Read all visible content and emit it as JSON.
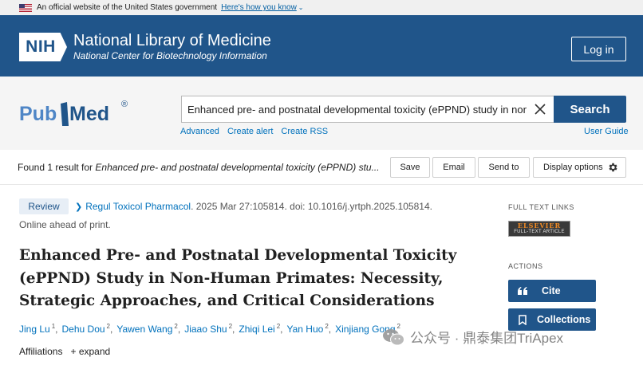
{
  "gov_banner": {
    "text": "An official website of the United States government",
    "link": "Here's how you know"
  },
  "nih": {
    "logo_text": "NIH",
    "title": "National Library of Medicine",
    "subtitle": "National Center for Biotechnology Information",
    "login": "Log in"
  },
  "search": {
    "logo_pub": "Pub",
    "logo_med": "Med",
    "logo_reg": "®",
    "query": "Enhanced pre- and postnatal developmental toxicity (ePPND) study in non-human primates",
    "button": "Search",
    "links": [
      "Advanced",
      "Create alert",
      "Create RSS"
    ],
    "user_guide": "User Guide"
  },
  "results": {
    "found_prefix": "Found 1 result for ",
    "found_query": "Enhanced pre- and postnatal developmental toxicity (ePPND) stu...",
    "save": "Save",
    "email": "Email",
    "send_to": "Send to",
    "display_options": "Display options"
  },
  "article": {
    "badge": "Review",
    "journal": "Regul Toxicol Pharmacol",
    "citation_rest": ". 2025 Mar 27:105814. doi: 10.1016/j.yrtph.2025.105814.",
    "status": "Online ahead of print.",
    "title": "Enhanced Pre- and Postnatal Developmental Toxicity (ePPND) Study in Non-Human Primates: Necessity, Strategic Approaches, and Critical Considerations",
    "authors": [
      {
        "name": "Jing Lu",
        "sup": "1"
      },
      {
        "name": "Dehu Dou",
        "sup": "2"
      },
      {
        "name": "Yawen Wang",
        "sup": "2"
      },
      {
        "name": "Jiaao Shu",
        "sup": "2"
      },
      {
        "name": "Zhiqi Lei",
        "sup": "2"
      },
      {
        "name": "Yan Huo",
        "sup": "2"
      },
      {
        "name": "Xinjiang Gong",
        "sup": "2"
      }
    ],
    "affiliations": "Affiliations",
    "expand": "+ expand"
  },
  "sidebar": {
    "full_text_links": "FULL TEXT LINKS",
    "elsevier_top": "ELSEVIER",
    "elsevier_bottom": "FULL-TEXT ARTICLE",
    "actions": "ACTIONS",
    "cite": "Cite",
    "collections": "Collections"
  },
  "watermark": {
    "text": "公众号 · 鼎泰集团TriApex"
  },
  "colors": {
    "nih_blue": "#20558a",
    "link_blue": "#0071bc",
    "pubmed_dark": "#20558a",
    "pubmed_light": "#4f86c6"
  }
}
